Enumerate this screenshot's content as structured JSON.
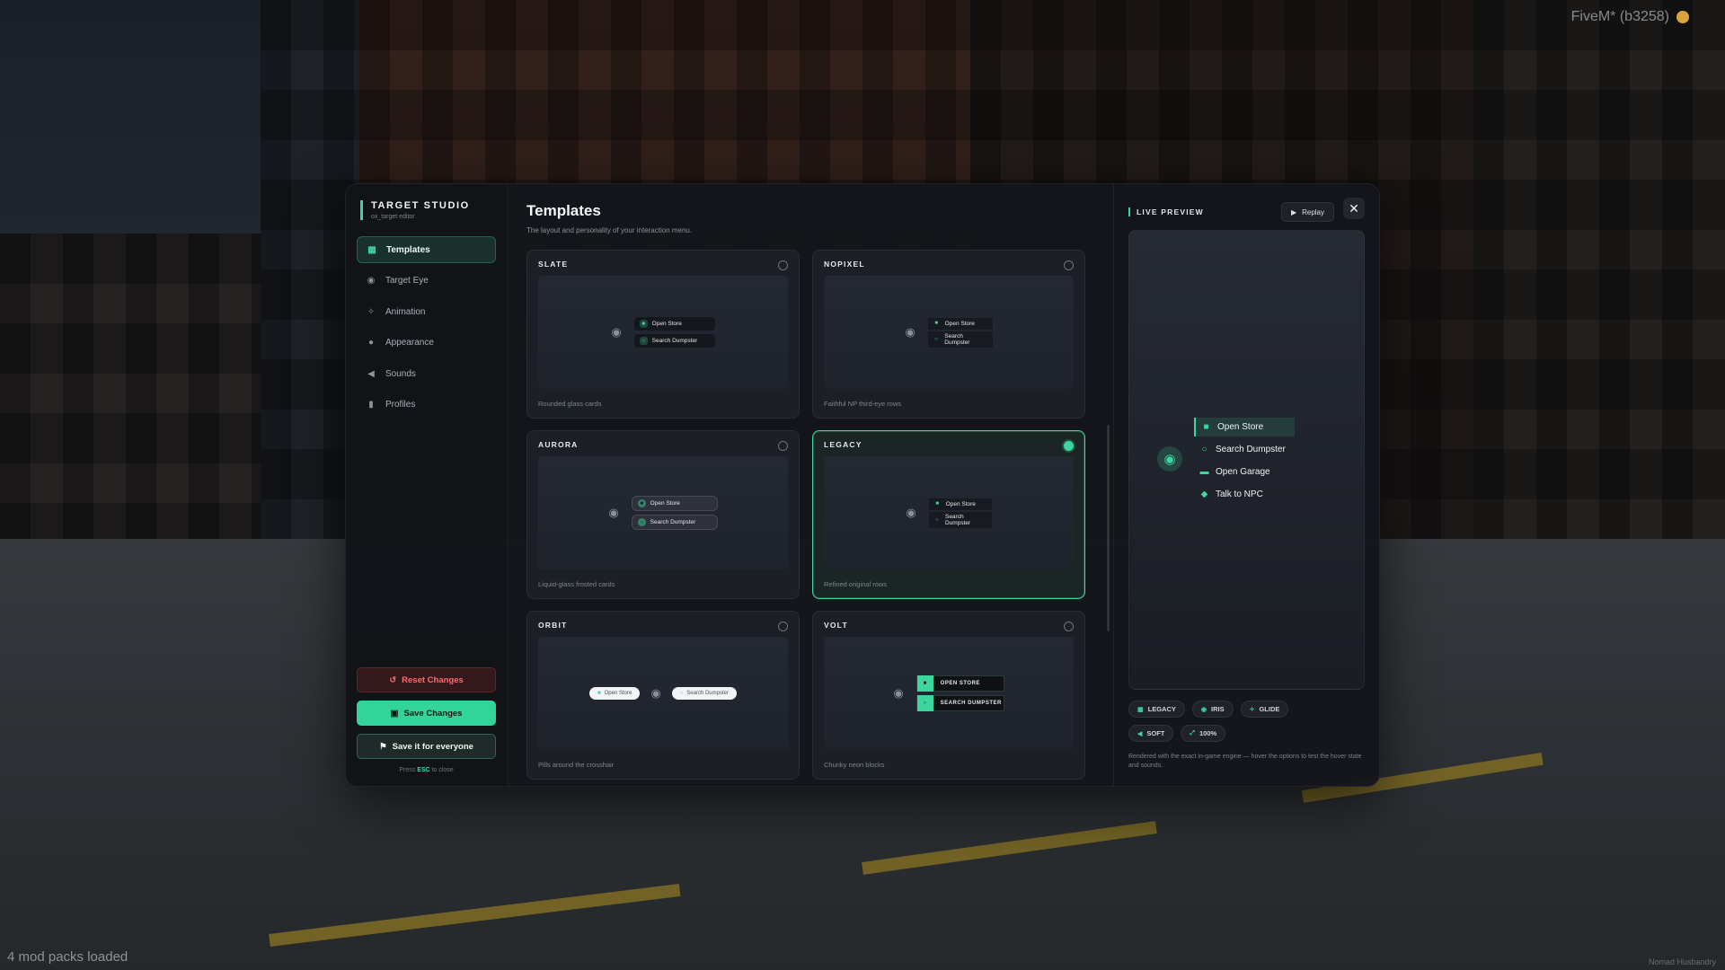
{
  "hud": {
    "build": "FiveM* (b3258)",
    "mods": "4 mod packs loaded",
    "signature": "Nomad Husbandry"
  },
  "sidebar": {
    "title": "TARGET STUDIO",
    "subtitle": "ox_target editor",
    "items": [
      {
        "label": "Templates",
        "icon": "grid-icon",
        "active": true
      },
      {
        "label": "Target Eye",
        "icon": "eye-icon",
        "active": false
      },
      {
        "label": "Animation",
        "icon": "sparkle-icon",
        "active": false
      },
      {
        "label": "Appearance",
        "icon": "palette-icon",
        "active": false
      },
      {
        "label": "Sounds",
        "icon": "speaker-icon",
        "active": false
      },
      {
        "label": "Profiles",
        "icon": "bookmark-icon",
        "active": false
      }
    ],
    "reset_label": "Reset Changes",
    "save_label": "Save Changes",
    "everyone_label": "Save it for everyone",
    "esc_pre": "Press",
    "esc_key": "ESC",
    "esc_post": "to close"
  },
  "main": {
    "title": "Templates",
    "subtitle": "The layout and personality of your interaction menu.",
    "cards": [
      {
        "name": "SLATE",
        "desc": "Rounded glass cards",
        "selected": false,
        "items": [
          "Open Store",
          "Search Dumpster"
        ]
      },
      {
        "name": "NOPIXEL",
        "desc": "Faithful NP third-eye rows",
        "selected": false,
        "items": [
          "Open Store",
          "Search Dumpster"
        ]
      },
      {
        "name": "AURORA",
        "desc": "Liquid-glass frosted cards",
        "selected": false,
        "items": [
          "Open Store",
          "Search Dumpster"
        ]
      },
      {
        "name": "LEGACY",
        "desc": "Refined original rows",
        "selected": true,
        "items": [
          "Open Store",
          "Search Dumpster"
        ]
      },
      {
        "name": "ORBIT",
        "desc": "Pills around the crosshair",
        "selected": false,
        "items": [
          "Open Store",
          "Search Dumpster"
        ]
      },
      {
        "name": "VOLT",
        "desc": "Chunky neon blocks",
        "selected": false,
        "items": [
          "OPEN STORE",
          "SEARCH DUMPSTER"
        ]
      }
    ]
  },
  "live": {
    "title": "LIVE PREVIEW",
    "replay_label": "Replay",
    "options": [
      {
        "label": "Open Store",
        "icon": "store-icon"
      },
      {
        "label": "Search Dumpster",
        "icon": "search-icon"
      },
      {
        "label": "Open Garage",
        "icon": "car-icon"
      },
      {
        "label": "Talk to NPC",
        "icon": "chat-icon"
      }
    ],
    "chips": [
      {
        "label": "LEGACY",
        "icon": "grid-icon"
      },
      {
        "label": "IRIS",
        "icon": "eye-icon"
      },
      {
        "label": "GLIDE",
        "icon": "sparkle-icon"
      },
      {
        "label": "SOFT",
        "icon": "speaker-icon"
      },
      {
        "label": "100%",
        "icon": "resize-icon"
      }
    ],
    "note": "Rendered with the exact in-game engine — hover the options to test the hover state and sounds."
  },
  "colors": {
    "accent": "#3dd6a0",
    "danger": "#ff6b6b",
    "panel": "#14161b"
  }
}
